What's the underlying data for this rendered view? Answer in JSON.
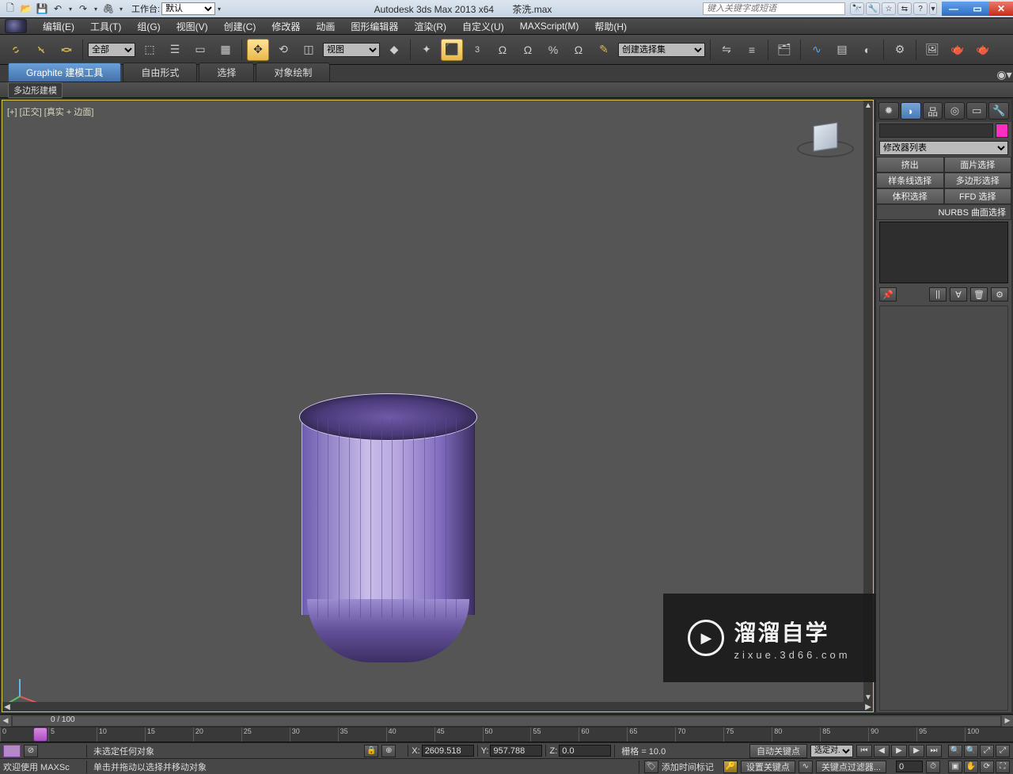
{
  "titlebar": {
    "workspace_label": "工作台:",
    "workspace_value": "默认",
    "app_title": "Autodesk 3ds Max  2013 x64",
    "file_title": "茶洗.max",
    "search_placeholder": "键入关键字或短语"
  },
  "menu": {
    "items": [
      "编辑(E)",
      "工具(T)",
      "组(G)",
      "视图(V)",
      "创建(C)",
      "修改器",
      "动画",
      "图形编辑器",
      "渲染(R)",
      "自定义(U)",
      "MAXScript(M)",
      "帮助(H)"
    ]
  },
  "toolbar": {
    "filter_all": "全部",
    "view_dropdown": "视图",
    "named_set_placeholder": "创建选择集"
  },
  "ribbon": {
    "tabs": [
      "Graphite 建模工具",
      "自由形式",
      "选择",
      "对象绘制"
    ],
    "active": 0,
    "strip_label": "多边形建模"
  },
  "viewport": {
    "label": "[+] [正交] [真实 + 边面]"
  },
  "cmdpanel": {
    "modifier_list": "修改器列表",
    "btns": [
      "挤出",
      "面片选择",
      "样条线选择",
      "多边形选择",
      "体积选择",
      "FFD 选择"
    ],
    "nurbs": "NURBS 曲面选择"
  },
  "timeline": {
    "frame_text": "0 / 100",
    "ticks": [
      "0",
      "5",
      "10",
      "15",
      "20",
      "25",
      "30",
      "35",
      "40",
      "45",
      "50",
      "55",
      "60",
      "65",
      "70",
      "75",
      "80",
      "85",
      "90",
      "95",
      "100"
    ]
  },
  "status": {
    "selection": "未选定任何对象",
    "x_label": "X:",
    "x_val": "2609.518",
    "y_label": "Y:",
    "y_val": "957.788",
    "z_label": "Z:",
    "z_val": "0.0",
    "grid": "栅格 = 10.0",
    "auto_key": "自动关键点",
    "filter_sel": "选定对...",
    "welcome": "欢迎使用  MAXSc",
    "hint": "单击并拖动以选择并移动对象",
    "time_tag": "添加时间标记",
    "set_key": "设置关键点",
    "key_filter": "关键点过滤器..."
  },
  "watermark": {
    "title": "溜溜自学",
    "sub": "zixue.3d66.com"
  }
}
